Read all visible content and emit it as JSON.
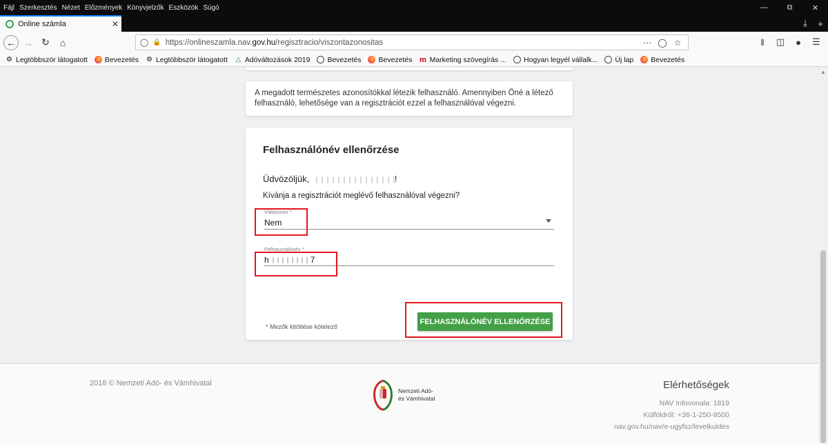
{
  "menu": [
    "Fájl",
    "Szerkesztés",
    "Nézet",
    "Előzmények",
    "Könyvjelzők",
    "Eszközök",
    "Súgó"
  ],
  "tab": {
    "title": "Online számla"
  },
  "url": {
    "prefix": "https://onlineszamla.nav.",
    "domain": "gov.hu",
    "path": "/regisztracio/viszontazonositas"
  },
  "bookmarks": [
    {
      "label": "Legtöbbször látogatott",
      "icon": "gear-icon"
    },
    {
      "label": "Bevezetés",
      "icon": "firefox-icon"
    },
    {
      "label": "Legtöbbször látogatott",
      "icon": "gear-icon"
    },
    {
      "label": "Adóváltozások 2019",
      "icon": "chart-icon"
    },
    {
      "label": "Bevezetés",
      "icon": "globe-icon"
    },
    {
      "label": "Bevezetés",
      "icon": "firefox-icon"
    },
    {
      "label": "Marketing szövegírás ...",
      "icon": "m-icon"
    },
    {
      "label": "Hogyan legyél vállalk...",
      "icon": "globe-icon"
    },
    {
      "label": "Új lap",
      "icon": "globe-icon"
    },
    {
      "label": "Bevezetés",
      "icon": "firefox-icon"
    }
  ],
  "info": {
    "text": "A megadott természetes azonosítókkal létezik felhasználó. Amennyiben Öné a létező felhasználó, lehetősége van a regisztrációt ezzel a felhasználóval végezni."
  },
  "form": {
    "title": "Felhasználónév ellenőrzése",
    "greeting": "Üdvözöljük,",
    "greeting_end": "!",
    "question": "Kívánja a regisztrációt meglévő felhasználóval végezni?",
    "select_label": "Válasszon *",
    "select_value": "Nem",
    "username_label": "Felhasználónév *",
    "username_prefix": "h",
    "username_suffix": "7",
    "required_note": "* Mezők kitöltése kötelező",
    "submit": "FELHASZNÁLÓNÉV ELLENŐRZÉSE"
  },
  "footer": {
    "copyright": "2018 © Nemzeti Adó- és Vámhivatal",
    "logo_line1": "Nemzeti Adó-",
    "logo_line2": "és Vámhivatal",
    "contact_title": "Elérhetőségek",
    "contact_lines": [
      "NAV Infovonala: 1819",
      "Külföldről: +36-1-250-9500",
      "nav.gov.hu/nav/e-ugyfsz/levelkuldes"
    ]
  },
  "colors": {
    "accent_green": "#43a047",
    "highlight_red": "#e0151d"
  }
}
